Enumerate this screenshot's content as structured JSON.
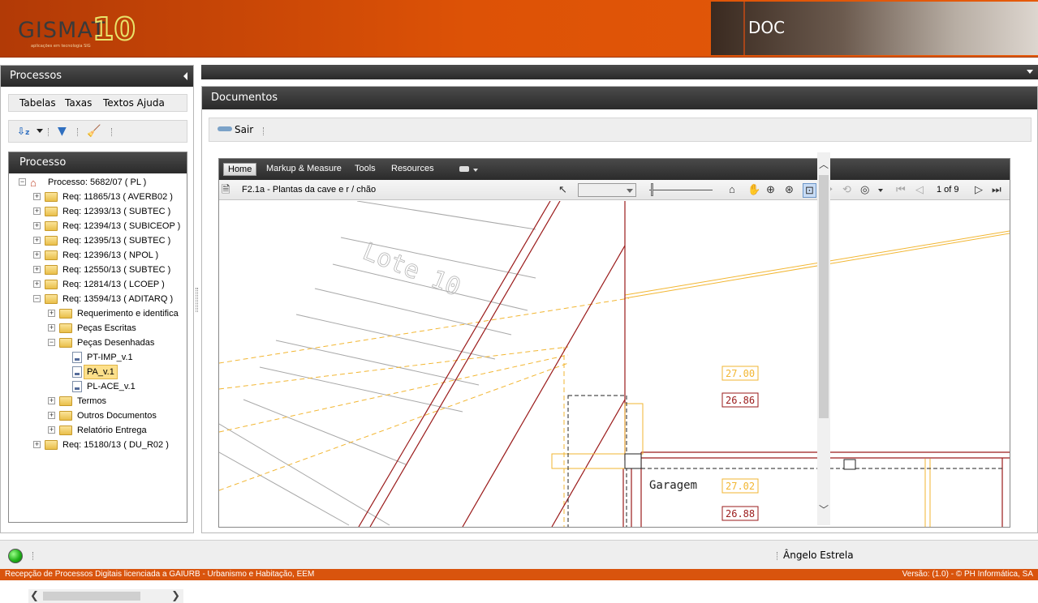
{
  "header": {
    "logo_text": "GISMAT",
    "logo_number": "10",
    "logo_tagline": "aplicações em tecnologia SIG",
    "module_title": "DOC"
  },
  "left_panel": {
    "title": "Processos",
    "menu": [
      "Tabelas",
      "Taxas",
      "Textos Ajuda"
    ],
    "toolbar_icons": [
      "sort-icon",
      "dropdown-icon",
      "filter-icon",
      "broom-icon"
    ],
    "process_box_title": "Processo",
    "tree": [
      {
        "label": "Processo: 5682/07 ( PL )",
        "level": 0,
        "expander": "−",
        "icon": "house"
      },
      {
        "label": "Req: 11865/13 ( AVERB02 )",
        "level": 1,
        "expander": "+",
        "icon": "folder"
      },
      {
        "label": "Req: 12393/13 ( SUBTEC )",
        "level": 1,
        "expander": "+",
        "icon": "folder"
      },
      {
        "label": "Req: 12394/13 ( SUBICEOP )",
        "level": 1,
        "expander": "+",
        "icon": "folder"
      },
      {
        "label": "Req: 12395/13 ( SUBTEC )",
        "level": 1,
        "expander": "+",
        "icon": "folder"
      },
      {
        "label": "Req: 12396/13 ( NPOL )",
        "level": 1,
        "expander": "+",
        "icon": "folder"
      },
      {
        "label": "Req: 12550/13 ( SUBTEC )",
        "level": 1,
        "expander": "+",
        "icon": "folder"
      },
      {
        "label": "Req: 12814/13 ( LCOEP )",
        "level": 1,
        "expander": "+",
        "icon": "folder"
      },
      {
        "label": "Req: 13594/13 ( ADITARQ )",
        "level": 1,
        "expander": "−",
        "icon": "folder"
      },
      {
        "label": "Requerimento e identifica",
        "level": 2,
        "expander": "+",
        "icon": "folder"
      },
      {
        "label": "Peças Escritas",
        "level": 2,
        "expander": "+",
        "icon": "folder"
      },
      {
        "label": "Peças Desenhadas",
        "level": 2,
        "expander": "−",
        "icon": "folder"
      },
      {
        "label": "PT-IMP_v.1",
        "level": 3,
        "expander": "",
        "icon": "file"
      },
      {
        "label": "PA_v.1",
        "level": 3,
        "expander": "",
        "icon": "file",
        "selected": true
      },
      {
        "label": "PL-ACE_v.1",
        "level": 3,
        "expander": "",
        "icon": "file"
      },
      {
        "label": "Termos",
        "level": 2,
        "expander": "+",
        "icon": "folder"
      },
      {
        "label": "Outros Documentos",
        "level": 2,
        "expander": "+",
        "icon": "folder"
      },
      {
        "label": "Relatório Entrega",
        "level": 2,
        "expander": "+",
        "icon": "folder"
      },
      {
        "label": "Req: 15180/13 ( DU_R02 )",
        "level": 1,
        "expander": "+",
        "icon": "folder"
      }
    ]
  },
  "right_panel": {
    "title": "Documentos",
    "exit_label": "Sair"
  },
  "pdf_viewer": {
    "tabs": [
      "Home",
      "Markup & Measure",
      "Tools",
      "Resources"
    ],
    "active_tab": "Home",
    "document_name": "F2.1a - Plantas da cave e r / chão",
    "page_indicator": "1 of 9",
    "drawing_labels": {
      "lote": "Lote 10",
      "garagem": "Garagem",
      "level_1_yellow": "27.00",
      "level_1_red": "26.86",
      "level_2_yellow": "27.02",
      "level_2_red": "26.88"
    }
  },
  "status": {
    "user": "Ângelo Estrela"
  },
  "footer": {
    "left": "Recepção de Processos Digitais licenciada a GAIURB - Urbanismo e Habitação, EEM",
    "right": "Versão: (1.0) - © PH Informática, SA"
  },
  "colors": {
    "brand_orange": "#dd5206",
    "dark_bar": "#333333",
    "selection": "#fde08a"
  }
}
